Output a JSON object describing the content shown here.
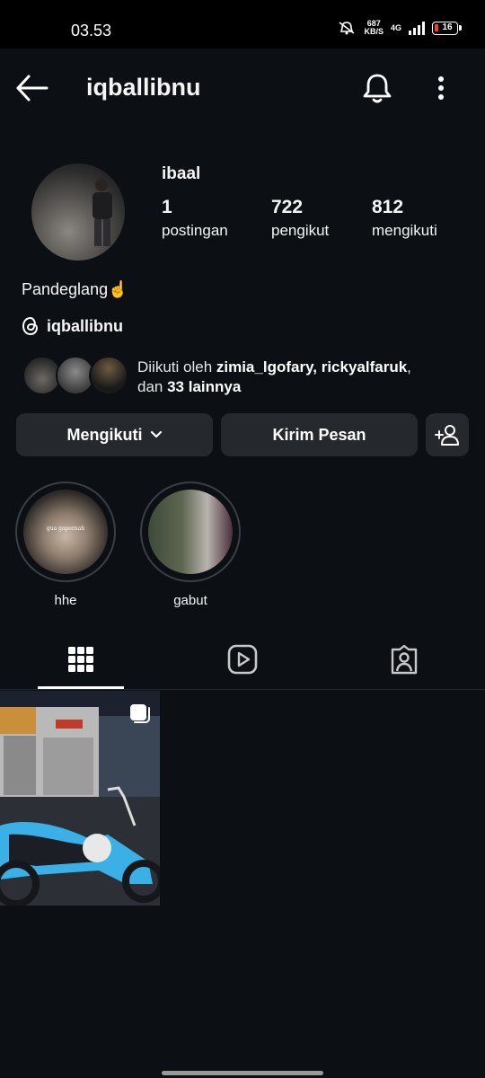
{
  "status_bar": {
    "time": "03.53",
    "net_speed_value": "687",
    "net_speed_unit": "KB/S",
    "network": "4G",
    "battery": "16"
  },
  "header": {
    "title": "iqballibnu"
  },
  "profile": {
    "display_name": "ibaal",
    "stats": [
      {
        "value": "1",
        "label": "postingan"
      },
      {
        "value": "722",
        "label": "pengikut"
      },
      {
        "value": "812",
        "label": "mengikuti"
      }
    ],
    "bio": "Pandeglang☝️",
    "threads_handle": "iqballibnu",
    "followed_by": {
      "prefix": "Diikuti oleh ",
      "names": "zimia_lgofary, rickyalfaruk",
      "middle": ",",
      "line2_prefix": "dan ",
      "others": "33 lainnya"
    }
  },
  "actions": {
    "following_label": "Mengikuti",
    "message_label": "Kirim Pesan"
  },
  "highlights": [
    {
      "label": "hhe",
      "caption": "gua gapernah"
    },
    {
      "label": "gabut"
    }
  ],
  "colors": {
    "background": "#0c1014",
    "button": "#25292e",
    "text": "#f5f5f5"
  }
}
